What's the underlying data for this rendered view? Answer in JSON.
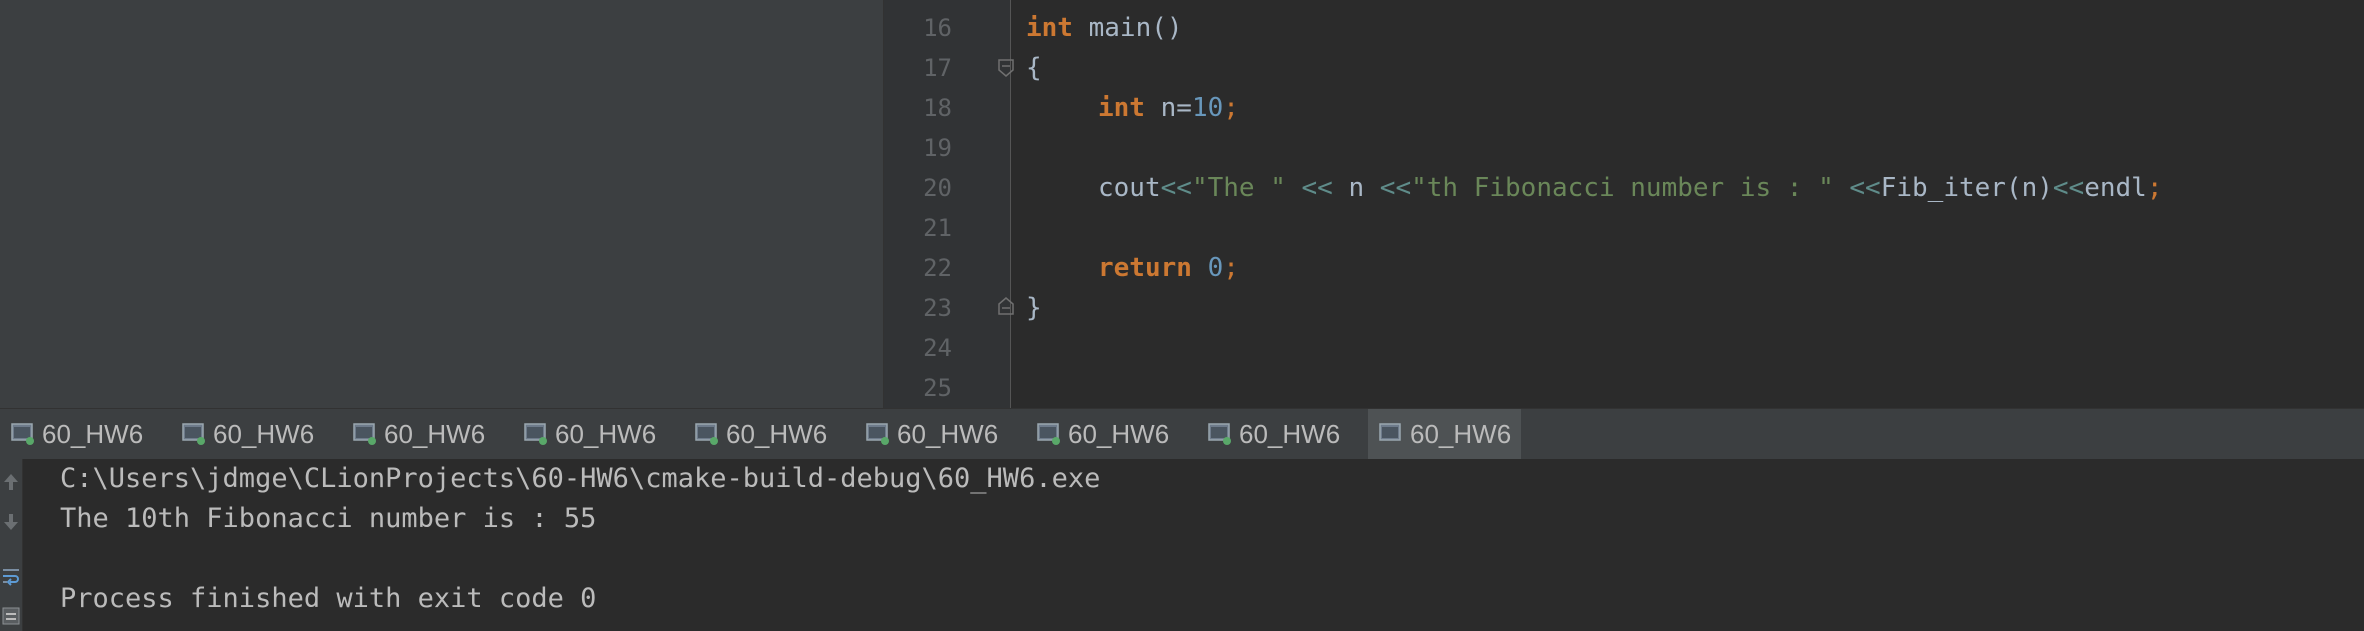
{
  "editor": {
    "line_numbers": [
      "16",
      "17",
      "18",
      "19",
      "20",
      "21",
      "22",
      "23",
      "24",
      "25"
    ],
    "lines": {
      "l16_kw": "int",
      "l16_rest": " main()",
      "l17": "{",
      "l18_kw": "int",
      "l18_var": " n=",
      "l18_num": "10",
      "l18_semi": ";",
      "l20_cout": "cout",
      "l20_op1": "<<",
      "l20_str1": "\"The \"",
      "l20_op2": " << ",
      "l20_n": "n",
      "l20_op3": " <<",
      "l20_str2": "\"th Fibonacci number is : \"",
      "l20_op4": " <<",
      "l20_call": "Fib_iter(n)",
      "l20_op5": "<<",
      "l20_endl": "endl",
      "l20_semi": ";",
      "l22_kw": "return",
      "l22_num": " 0",
      "l22_semi": ";",
      "l23": "}"
    }
  },
  "run_tabs": [
    {
      "label": "60_HW6"
    },
    {
      "label": "60_HW6"
    },
    {
      "label": "60_HW6"
    },
    {
      "label": "60_HW6"
    },
    {
      "label": "60_HW6"
    },
    {
      "label": "60_HW6"
    },
    {
      "label": "60_HW6"
    },
    {
      "label": "60_HW6"
    },
    {
      "label": "60_HW6"
    }
  ],
  "console": {
    "lines": [
      "C:\\Users\\jdmge\\CLionProjects\\60-HW6\\cmake-build-debug\\60_HW6.exe",
      "The 10th Fibonacci number is : 55",
      "",
      "Process finished with exit code 0"
    ]
  },
  "icons": {
    "run_tab": "console-window-icon",
    "toolbar": [
      "arrow-up-icon",
      "arrow-down-icon",
      "soft-wrap-icon",
      "scroll-end-icon"
    ]
  },
  "colors": {
    "keyword": "#cc7832",
    "number": "#6897bb",
    "string": "#6a8759",
    "text": "#a9b7c6",
    "background": "#2b2b2b",
    "panel": "#3c3f41",
    "running_dot": "#59a869"
  }
}
